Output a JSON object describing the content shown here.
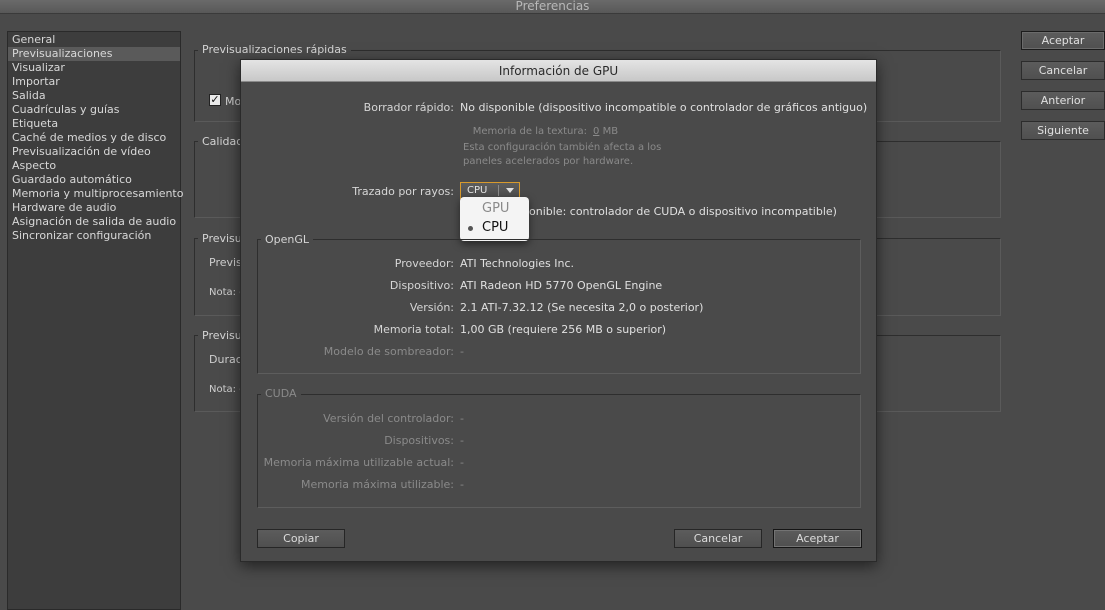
{
  "window": {
    "title": "Preferencias"
  },
  "sidebar": {
    "items": [
      {
        "label": "General"
      },
      {
        "label": "Previsualizaciones"
      },
      {
        "label": "Visualizar"
      },
      {
        "label": "Importar"
      },
      {
        "label": "Salida"
      },
      {
        "label": "Cuadrículas y guías"
      },
      {
        "label": "Etiqueta"
      },
      {
        "label": "Caché de medios y de disco"
      },
      {
        "label": "Previsualización de vídeo"
      },
      {
        "label": "Aspecto"
      },
      {
        "label": "Guardado automático"
      },
      {
        "label": "Memoria y multiprocesamiento"
      },
      {
        "label": "Hardware de audio"
      },
      {
        "label": "Asignación de salida de audio"
      },
      {
        "label": "Sincronizar configuración"
      }
    ],
    "selected_index": 1
  },
  "main": {
    "group_fast_previews": "Previsualizaciones rápidas",
    "checkbox_label": "Mo",
    "checkbox_mark": "✓",
    "group_quality": "Calidad",
    "group_prev2": "Previsu",
    "prev2_line1": "Previs",
    "prev2_note": "Nota: c",
    "group_prev3": "Previsu",
    "prev3_line1": "Durac",
    "prev3_note": "Nota: c"
  },
  "right_buttons": {
    "ok": "Aceptar",
    "cancel": "Cancelar",
    "prev": "Anterior",
    "next": "Siguiente"
  },
  "dialog": {
    "title": "Información de GPU",
    "fast_draft_label": "Borrador rápido:",
    "fast_draft_value": "No disponible (dispositivo incompatible o controlador de gráficos antiguo)",
    "texture_memory_label": "Memoria de la textura:",
    "texture_memory_value": "0",
    "texture_memory_unit": "MB",
    "note_line1": "Esta configuración también afecta a los",
    "note_line2": "paneles acelerados por hardware.",
    "ray_trace_label": "Trazado por rayos:",
    "ray_trace_selected": "CPU",
    "ray_trace_options": [
      "GPU",
      "CPU"
    ],
    "ray_trace_status": "onible: controlador de CUDA o dispositivo incompatible)",
    "opengl": {
      "title": "OpenGL",
      "rows": [
        {
          "label": "Proveedor:",
          "value": "ATI Technologies Inc.",
          "dim": false
        },
        {
          "label": "Dispositivo:",
          "value": "ATI Radeon HD 5770 OpenGL Engine",
          "dim": false
        },
        {
          "label": "Versión:",
          "value": "2.1 ATI-7.32.12 (Se necesita 2,0 o posterior)",
          "dim": false
        },
        {
          "label": "Memoria total:",
          "value": "1,00 GB (requiere 256 MB o superior)",
          "dim": false
        },
        {
          "label": "Modelo de sombreador:",
          "value": "-",
          "dim": true
        }
      ]
    },
    "cuda": {
      "title": "CUDA",
      "rows": [
        {
          "label": "Versión del controlador:",
          "value": "-"
        },
        {
          "label": "Dispositivos:",
          "value": "-"
        },
        {
          "label": "Memoria máxima utilizable actual:",
          "value": "-"
        },
        {
          "label": "Memoria máxima utilizable:",
          "value": "-"
        }
      ]
    },
    "buttons": {
      "copy": "Copiar",
      "cancel": "Cancelar",
      "ok": "Aceptar"
    }
  }
}
